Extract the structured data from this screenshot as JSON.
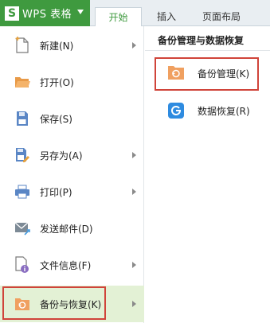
{
  "topbar": {
    "app_title": "WPS 表格",
    "logo_letter": "S",
    "tabs": [
      "开始",
      "插入",
      "页面布局"
    ]
  },
  "menu": {
    "items": [
      {
        "label": "新建(N)",
        "icon": "new-document-icon",
        "has_submenu": true
      },
      {
        "label": "打开(O)",
        "icon": "open-folder-icon",
        "has_submenu": false
      },
      {
        "label": "保存(S)",
        "icon": "save-icon",
        "has_submenu": false
      },
      {
        "label": "另存为(A)",
        "icon": "save-as-icon",
        "has_submenu": true
      },
      {
        "label": "打印(P)",
        "icon": "print-icon",
        "has_submenu": true
      },
      {
        "label": "发送邮件(D)",
        "icon": "send-mail-icon",
        "has_submenu": false
      },
      {
        "label": "文件信息(F)",
        "icon": "file-info-icon",
        "has_submenu": true
      },
      {
        "label": "备份与恢复(K)",
        "icon": "backup-restore-icon",
        "has_submenu": true,
        "active": true
      }
    ]
  },
  "panel": {
    "title": "备份管理与数据恢复",
    "items": [
      {
        "label": "备份管理(K)",
        "icon": "backup-manage-icon"
      },
      {
        "label": "数据恢复(R)",
        "icon": "data-recovery-icon"
      }
    ]
  },
  "colors": {
    "brand_green": "#3f9a3f",
    "highlight_red": "#d0443a",
    "active_bg": "#e3f1d5",
    "folder_orange": "#f0a060",
    "recovery_blue": "#2e8be0"
  }
}
